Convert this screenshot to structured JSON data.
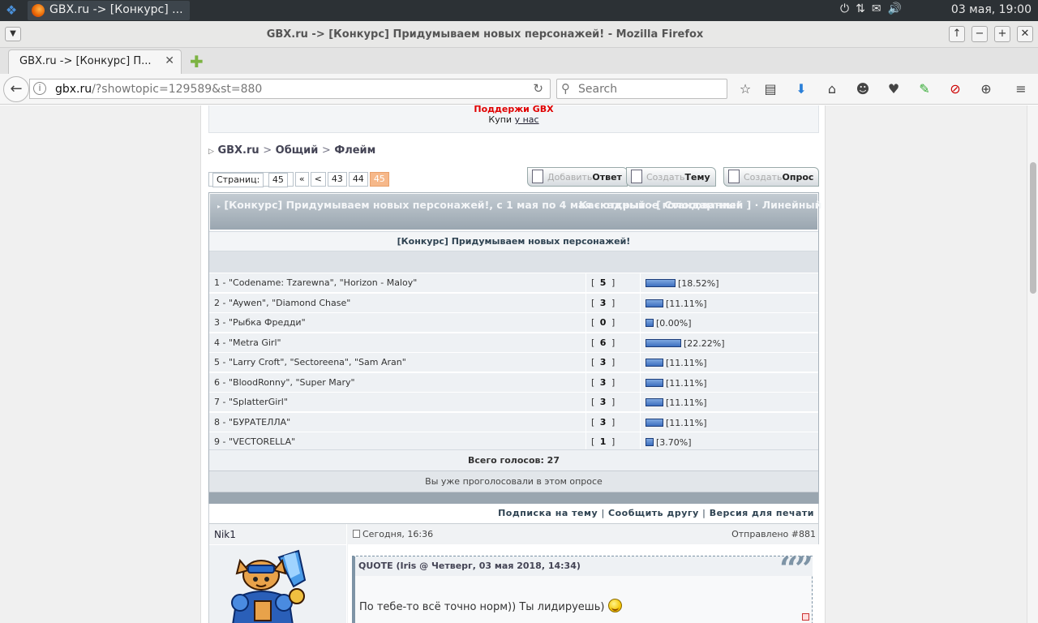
{
  "panel": {
    "task_title": "GBX.ru -> [Конкурс] ...",
    "clock": "03 мая, 19:00"
  },
  "window": {
    "title": "GBX.ru -> [Конкурс] Придумываем новых персонажей! - Mozilla Firefox"
  },
  "tab": {
    "title": "GBX.ru -> [Конкурс] П..."
  },
  "nav": {
    "url_host": "gbx.ru",
    "url_path": "/?showtopic=129589&st=880",
    "search_placeholder": "Search"
  },
  "banner": {
    "support": "Поддержи GBX",
    "buy_prefix": "Купи ",
    "buy_link": "у нас"
  },
  "breadcrumb": {
    "root": "GBX.ru",
    "sep": ">",
    "forum": "Общий",
    "sub": "Флейм"
  },
  "pager": {
    "label": "Страниц:",
    "total": "45",
    "first": "«",
    "prev": "<",
    "pages": [
      "43",
      "44"
    ],
    "current": "45"
  },
  "actions": [
    {
      "light": "Добавить",
      "bold": "Ответ"
    },
    {
      "light": "Создать",
      "bold": "Тему"
    },
    {
      "light": "Создать",
      "bold": "Опрос"
    }
  ],
  "poll": {
    "header_title": "[Конкурс] Придумываем новых персонажей!, с 1 мая по 4 мая - открытое голосование!",
    "view_modes": "Каскадный · [ Стандартный ] · Линейный",
    "question": "[Конкурс] Придумываем новых персонажей!",
    "rows": [
      {
        "label": "1 - \"Codename: Tzarewna\", \"Horizon - Maloy\"",
        "votes": "5",
        "percent": "[18.52%]",
        "pct_value": 18.52
      },
      {
        "label": "2 - \"Aywen\", \"Diamond Chase\"",
        "votes": "3",
        "percent": "[11.11%]",
        "pct_value": 11.11
      },
      {
        "label": "3 - \"Рыбка Фредди\"",
        "votes": "0",
        "percent": "[0.00%]",
        "pct_value": 0.0
      },
      {
        "label": "4 - \"Metra Girl\"",
        "votes": "6",
        "percent": "[22.22%]",
        "pct_value": 22.22
      },
      {
        "label": "5 - \"Larry Croft\", \"Sectoreena\", \"Sam Aran\"",
        "votes": "3",
        "percent": "[11.11%]",
        "pct_value": 11.11
      },
      {
        "label": "6 - \"BloodRonny\", \"Super Mary\"",
        "votes": "3",
        "percent": "[11.11%]",
        "pct_value": 11.11
      },
      {
        "label": "7 - \"SplatterGirl\"",
        "votes": "3",
        "percent": "[11.11%]",
        "pct_value": 11.11
      },
      {
        "label": "8 - \"БУРАТЕЛЛА\"",
        "votes": "3",
        "percent": "[11.11%]",
        "pct_value": 11.11
      },
      {
        "label": "9 - \"VECTORELLA\"",
        "votes": "1",
        "percent": "[3.70%]",
        "pct_value": 3.7
      }
    ],
    "total": "Всего голосов: 27",
    "voted_msg": "Вы уже проголосовали в этом опросе"
  },
  "options": {
    "subscribe": "Подписка на тему",
    "tell": "Сообщить другу",
    "print": "Версия для печати",
    "sep": "|"
  },
  "post": {
    "author": "Nik1",
    "date": "Сегодня, 16:36",
    "sent_label": "Отправлено",
    "number": "#881",
    "quote_header": "QUOTE (Iris @ Четверг, 03 мая 2018, 14:34)",
    "quote_mark": "“”",
    "quote_text": "По тебе-то всё точно норм)) Ты лидируешь)"
  },
  "colors": {
    "bar_fill": "#4a7bd0",
    "current_page": "#f6b88a",
    "support_red": "#e00000"
  }
}
